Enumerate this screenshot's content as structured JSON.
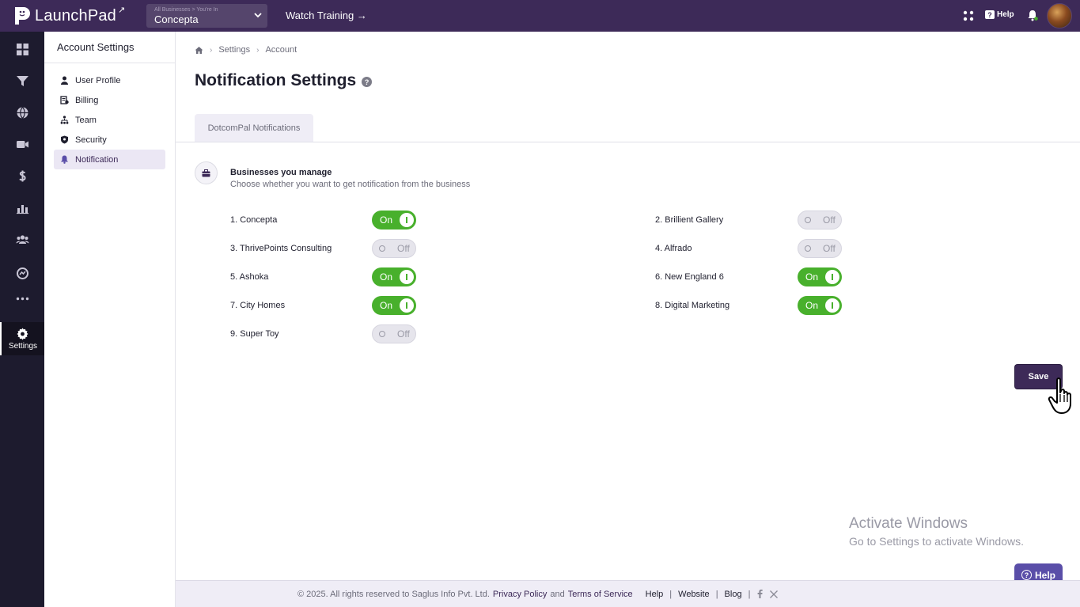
{
  "app": {
    "name": "LaunchPad",
    "brand_color": "#3d2a58",
    "accent_on": "#48b02c"
  },
  "topbar": {
    "business_selector_caption": "All Businesses > You're In",
    "business_selector_value": "Concepta",
    "watch_training": "Watch Training →",
    "help_label": "Help",
    "help_icon_glyph": "?"
  },
  "rail": {
    "icons": [
      "dashboard-icon",
      "funnel-icon",
      "globe-icon",
      "video-icon",
      "dollar-icon",
      "chart-icon",
      "users-icon",
      "analytics-icon",
      "more-icon"
    ],
    "settings_label": "Settings"
  },
  "sidebar": {
    "title": "Account Settings",
    "items": [
      {
        "label": "User Profile",
        "icon": "user-icon"
      },
      {
        "label": "Billing",
        "icon": "billing-icon"
      },
      {
        "label": "Team",
        "icon": "team-icon"
      },
      {
        "label": "Security",
        "icon": "shield-icon"
      },
      {
        "label": "Notification",
        "icon": "bell-icon",
        "active": true
      }
    ]
  },
  "breadcrumb": {
    "items": [
      "Settings",
      "Account"
    ]
  },
  "page": {
    "title": "Notification Settings",
    "title_help_glyph": "?",
    "tab": "DotcomPal Notifications",
    "section_title": "Businesses you manage",
    "section_subtitle": "Choose whether you want to get notification from the business"
  },
  "businesses": [
    {
      "label": "1. Concepta",
      "state": "On"
    },
    {
      "label": "2. Brillient Gallery",
      "state": "Off"
    },
    {
      "label": "3. ThrivePoints Consulting",
      "state": "Off"
    },
    {
      "label": "4. Alfrado",
      "state": "Off"
    },
    {
      "label": "5. Ashoka",
      "state": "On"
    },
    {
      "label": "6. New England 6",
      "state": "On"
    },
    {
      "label": "7. City Homes",
      "state": "On"
    },
    {
      "label": "8. Digital Marketing",
      "state": "On"
    },
    {
      "label": "9. Super Toy",
      "state": "Off"
    }
  ],
  "actions": {
    "save_label": "Save"
  },
  "watermark": {
    "line1": "Activate Windows",
    "line2": "Go to Settings to activate Windows."
  },
  "help_float": {
    "label": "Help",
    "glyph": "?"
  },
  "footer": {
    "copyright": "©  2025. All rights reserved to Saglus Info Pvt. Ltd.",
    "privacy": "Privacy Policy",
    "and": "and",
    "terms": "Terms of Service",
    "links": [
      "Help",
      "Website",
      "Blog"
    ],
    "pipe": "|"
  }
}
